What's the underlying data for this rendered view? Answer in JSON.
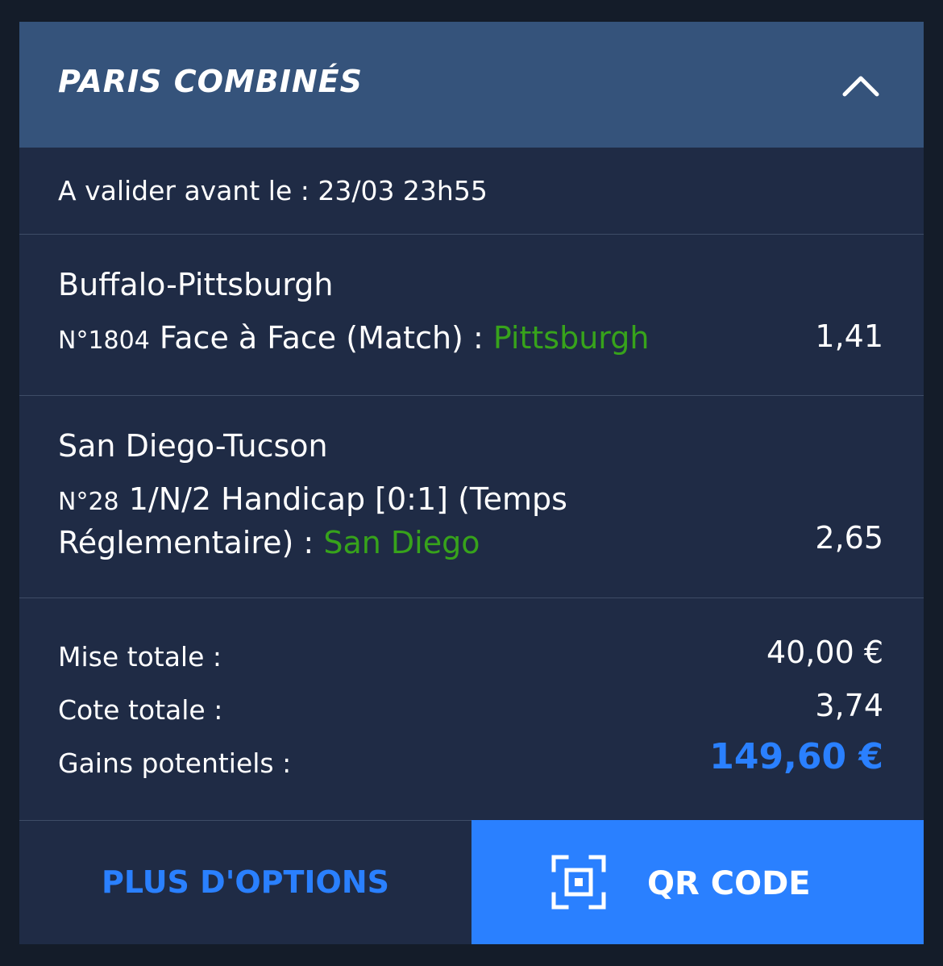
{
  "header": {
    "title": "PARIS COMBINÉS",
    "collapse_icon": "chevron-up-icon"
  },
  "deadline": "A valider avant le : 23/03 23h55",
  "bets": [
    {
      "match": "Buffalo-Pittsburgh",
      "number": "N°1804",
      "market": "Face à Face (Match) :",
      "selection": "Pittsburgh",
      "odds": "1,41"
    },
    {
      "match": "San Diego-Tucson",
      "number": "N°28",
      "market": "1/N/2 Handicap [0:1] (Temps Réglementaire) :",
      "selection": "San Diego",
      "odds": "2,65"
    }
  ],
  "summary": {
    "stake_label": "Mise totale :",
    "stake_value": "40,00 €",
    "odds_label": "Cote totale :",
    "odds_value": "3,74",
    "gains_label": "Gains potentiels :",
    "gains_value": "149,60 €"
  },
  "actions": {
    "options_label": "PLUS D'OPTIONS",
    "qr_label": "QR CODE",
    "qr_icon": "qr-scan-icon"
  },
  "colors": {
    "header_bg": "#35537b",
    "card_bg": "#1f2b45",
    "selection": "#37a31b",
    "accent": "#2a80ff"
  }
}
